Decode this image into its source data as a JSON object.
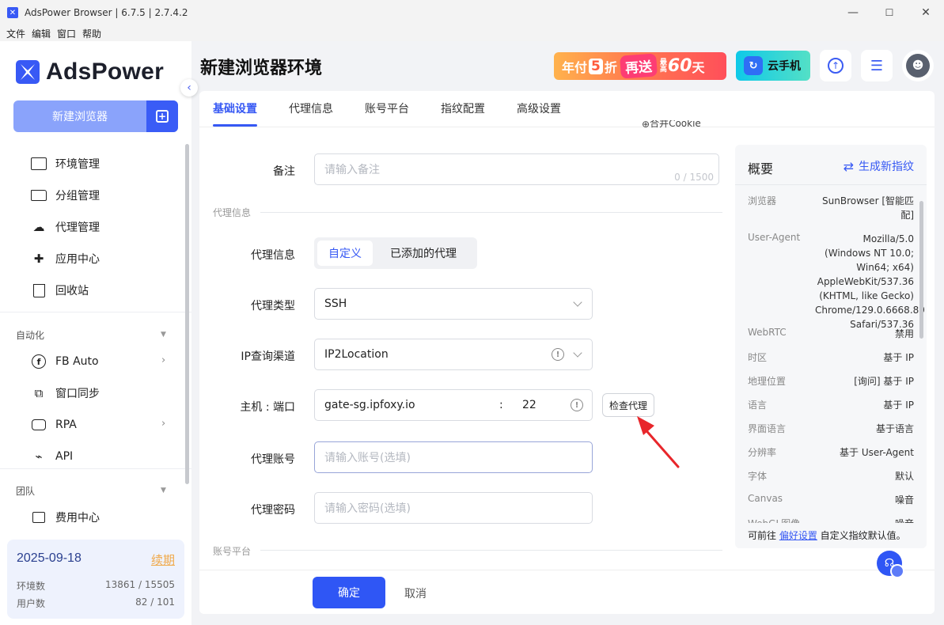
{
  "window": {
    "title": "AdsPower Browser | 6.7.5 | 2.7.4.2",
    "min": "—",
    "max": "☐",
    "close": "✕"
  },
  "menu": [
    "文件",
    "编辑",
    "窗口",
    "帮助"
  ],
  "sidebar": {
    "logo_text": "AdsPower",
    "new_browser": "新建浏览器",
    "nav": [
      {
        "label": "环境管理",
        "icon": "list-icon"
      },
      {
        "label": "分组管理",
        "icon": "folder-icon"
      },
      {
        "label": "代理管理",
        "icon": "cloud-proxy-icon"
      },
      {
        "label": "应用中心",
        "icon": "puzzle-icon"
      },
      {
        "label": "回收站",
        "icon": "trash-icon"
      }
    ],
    "section_auto": "自动化",
    "auto_items": [
      {
        "label": "FB Auto",
        "icon": "facebook-icon"
      },
      {
        "label": "窗口同步",
        "icon": "sync-icon"
      },
      {
        "label": "RPA",
        "icon": "robot-icon"
      },
      {
        "label": "API",
        "icon": "plug-icon"
      }
    ],
    "section_team": "团队",
    "team_items": [
      {
        "label": "费用中心",
        "icon": "wallet-icon"
      }
    ],
    "account": {
      "date": "2025-09-18",
      "renew": "续期",
      "env_label": "环境数",
      "env_value": "13861 / 15505",
      "user_label": "用户数",
      "user_value": "82 / 101"
    }
  },
  "header": {
    "title": "新建浏览器环境",
    "promo": {
      "p1": "年付",
      "five": "5",
      "zhe": "折",
      "badge": "再送",
      "mini": "最高",
      "big": "60",
      "day": "天"
    },
    "cloud_phone": "云手机"
  },
  "tabs": [
    "基础设置",
    "代理信息",
    "账号平台",
    "指纹配置",
    "高级设置"
  ],
  "form": {
    "partial_top": "合并Cookie",
    "remark_label": "备注",
    "remark_placeholder": "请输入备注",
    "remark_counter": "0 / 1500",
    "section_proxy": "代理信息",
    "proxy_info_label": "代理信息",
    "proxy_info_options": [
      "自定义",
      "已添加的代理"
    ],
    "proxy_type_label": "代理类型",
    "proxy_type_value": "SSH",
    "ip_channel_label": "IP查询渠道",
    "ip_channel_value": "IP2Location",
    "host_label": "主机 : 端口",
    "host_value": "gate-sg.ipfoxy.io",
    "colon": ":",
    "port_value": "22",
    "check_proxy": "检查代理",
    "account_label": "代理账号",
    "account_placeholder": "请输入账号(选填)",
    "password_label": "代理密码",
    "password_placeholder": "请输入密码(选填)",
    "section_platform": "账号平台"
  },
  "summary": {
    "title": "概要",
    "generate": "生成新指纹",
    "rows": [
      {
        "k": "浏览器",
        "v": "SunBrowser [智能匹配]"
      },
      {
        "k": "User-Agent",
        "v": "Mozilla/5.0 (Windows NT 10.0; Win64; x64) AppleWebKit/537.36 (KHTML, like Gecko) Chrome/129.0.6668.89 Safari/537.36"
      },
      {
        "k": "WebRTC",
        "v": "禁用"
      },
      {
        "k": "时区",
        "v": "基于 IP"
      },
      {
        "k": "地理位置",
        "v": "[询问] 基于 IP"
      },
      {
        "k": "语言",
        "v": "基于 IP"
      },
      {
        "k": "界面语言",
        "v": "基于语言"
      },
      {
        "k": "分辨率",
        "v": "基于 User-Agent"
      },
      {
        "k": "字体",
        "v": "默认"
      },
      {
        "k": "Canvas",
        "v": "噪音"
      },
      {
        "k": "WebGL图像",
        "v": "噪音"
      }
    ],
    "foot_pre": "可前往 ",
    "foot_link": "偏好设置",
    "foot_post": " 自定义指纹默认值。"
  },
  "footer": {
    "ok": "确定",
    "cancel": "取消"
  }
}
